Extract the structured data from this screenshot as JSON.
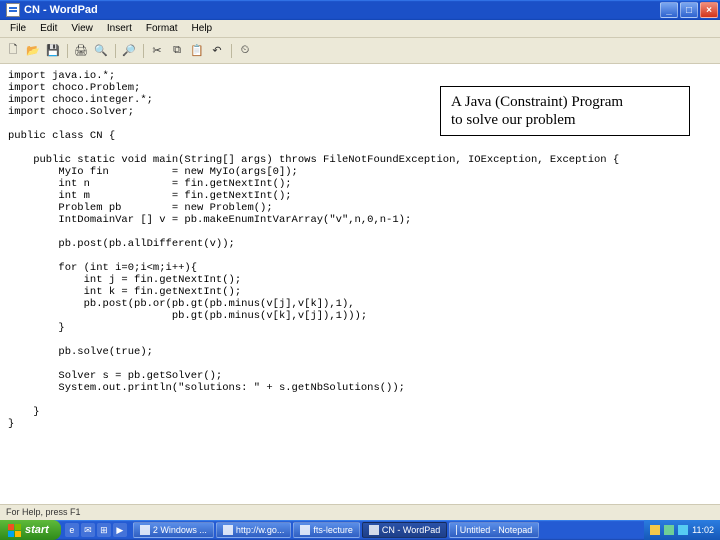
{
  "window": {
    "title": "CN - WordPad"
  },
  "menu": {
    "file": "File",
    "edit": "Edit",
    "view": "View",
    "insert": "Insert",
    "format": "Format",
    "help": "Help"
  },
  "toolbar_icons": {
    "new": "🗋",
    "open": "📂",
    "save": "💾",
    "print": "🖨",
    "preview": "🔍",
    "find": "🔎",
    "cut": "✂",
    "copy": "⧉",
    "paste": "📋",
    "undo": "↶",
    "date": "⏲"
  },
  "annotation": {
    "line1": "A Java (Constraint) Program",
    "line2": "to solve our problem"
  },
  "code": "import java.io.*;\nimport choco.Problem;\nimport choco.integer.*;\nimport choco.Solver;\n\npublic class CN {\n\n    public static void main(String[] args) throws FileNotFoundException, IOException, Exception {\n        MyIo fin          = new MyIo(args[0]);\n        int n             = fin.getNextInt();\n        int m             = fin.getNextInt();\n        Problem pb        = new Problem();\n        IntDomainVar [] v = pb.makeEnumIntVarArray(\"v\",n,0,n-1);\n\n        pb.post(pb.allDifferent(v));\n\n        for (int i=0;i<m;i++){\n            int j = fin.getNextInt();\n            int k = fin.getNextInt();\n            pb.post(pb.or(pb.gt(pb.minus(v[j],v[k]),1),\n                          pb.gt(pb.minus(v[k],v[j]),1)));\n        }\n\n        pb.solve(true);\n\n        Solver s = pb.getSolver();\n        System.out.println(\"solutions: \" + s.getNbSolutions());\n\n    }\n}",
  "statusbar": {
    "text": "For Help, press F1"
  },
  "taskbar": {
    "start": "start",
    "tasks": [
      {
        "label": "2 Windows ..."
      },
      {
        "label": "http://w.go..."
      },
      {
        "label": "fts-lecture"
      },
      {
        "label": "CN - WordPad",
        "active": true
      },
      {
        "label": "Untitled - Notepad"
      }
    ],
    "clock": "11:02"
  }
}
